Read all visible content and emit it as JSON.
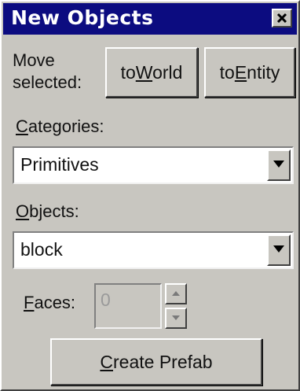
{
  "window": {
    "title": "New Objects",
    "close_icon": "close-icon"
  },
  "move": {
    "label_line1": "Move",
    "label_line2": "selected:",
    "to_world": {
      "before": "to",
      "mnemonic": "W",
      "after": "orld"
    },
    "to_entity": {
      "before": "to",
      "mnemonic": "E",
      "after": "ntity"
    }
  },
  "categories": {
    "label_mnemonic": "C",
    "label_rest": "ategories:",
    "selected": "Primitives"
  },
  "objects": {
    "label_mnemonic": "O",
    "label_rest": "bjects:",
    "selected": "block"
  },
  "faces": {
    "label_mnemonic": "F",
    "label_rest": "aces:",
    "value": "0"
  },
  "create_prefab": {
    "mnemonic": "C",
    "rest": "reate Prefab"
  },
  "colors": {
    "titlebar": "#0c0c80",
    "face": "#c8c6c0"
  }
}
